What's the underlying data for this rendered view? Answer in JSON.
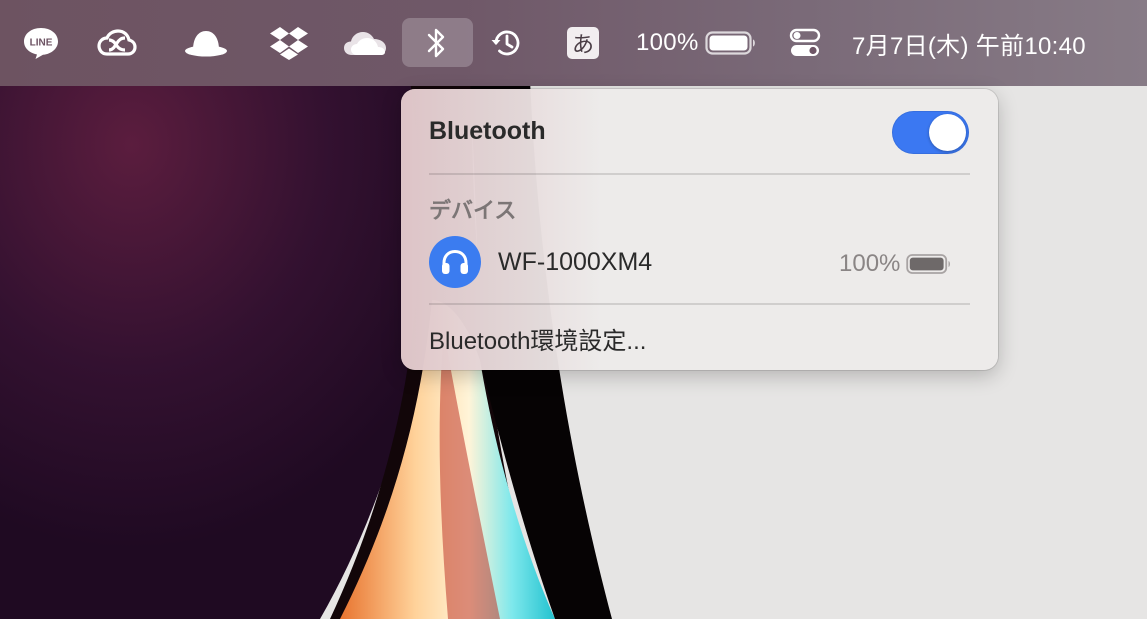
{
  "menubar": {
    "icons": [
      "line-icon",
      "creative-cloud-icon",
      "bowler-hat-icon",
      "dropbox-icon",
      "cloud-icon",
      "bluetooth-icon",
      "time-machine-icon",
      "control-center-icon"
    ],
    "ime_label": "あ",
    "battery_text": "100%",
    "battery_level": 1.0,
    "clock": "7月7日(木) 午前10:40",
    "active_item": "bluetooth"
  },
  "bluetooth_panel": {
    "title": "Bluetooth",
    "enabled": true,
    "toggle_color": "#3b78f2",
    "section_devices": "デバイス",
    "devices": [
      {
        "name": "WF-1000XM4",
        "battery": "100%",
        "battery_level": 1.0,
        "icon": "headphones-icon",
        "icon_color": "#3b7cf0"
      }
    ],
    "preferences_link": "Bluetooth環境設定..."
  }
}
